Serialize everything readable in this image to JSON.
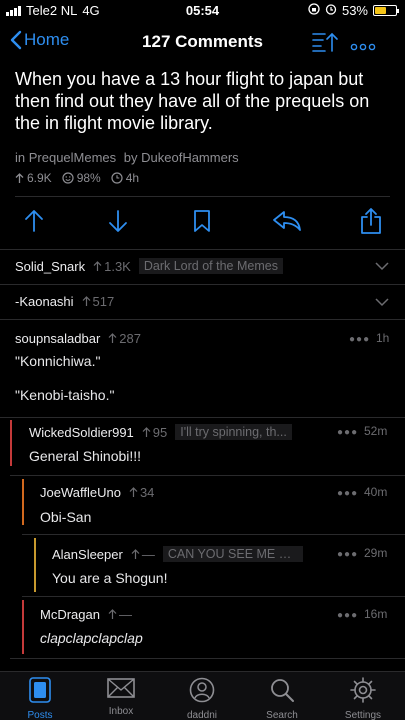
{
  "status_bar": {
    "carrier": "Tele2 NL",
    "network": "4G",
    "time": "05:54",
    "battery": "53%",
    "battery_level": 0.53
  },
  "nav": {
    "back_label": "Home",
    "title": "127 Comments"
  },
  "post": {
    "title": "When you have a 13 hour flight to japan but then find out they have all of the prequels on the in flight movie library.",
    "subreddit": "in PrequelMemes",
    "author": "by DukeofHammers",
    "score": "6.9K",
    "ratio": "98%",
    "age": "4h"
  },
  "comments": [
    {
      "author": "Solid_Snark",
      "score": "1.3K",
      "flair": "Dark Lord of the Memes",
      "collapsed": true
    },
    {
      "author": "-Kaonashi",
      "score": "517",
      "collapsed": true
    },
    {
      "author": "soupnsaladbar",
      "score": "287",
      "time": "1h",
      "body1": "\"Konnichiwa.\"",
      "body2": "\"Kenobi-taisho.\""
    },
    {
      "author": "WickedSoldier991",
      "score": "95",
      "flair": "I'll try spinning, th...",
      "time": "52m",
      "body": "General Shinobi!!!",
      "bar_color": "#c43a3a"
    },
    {
      "author": "JoeWaffleUno",
      "score": "34",
      "time": "40m",
      "body": "Obi-San",
      "bar_color": "#d2691e"
    },
    {
      "author": "AlanSleeper",
      "score": "—",
      "flair": "CAN YOU SEE ME N...",
      "time": "29m",
      "body": "You are a Shogun!",
      "bar_color": "#c89a2e"
    },
    {
      "author": "McDragan",
      "score": "—",
      "time": "16m",
      "body": "clapclapclapclap",
      "bar_color": "#c43a3a"
    }
  ],
  "tabs": [
    {
      "label": "Posts",
      "icon": "posts-icon",
      "active": true
    },
    {
      "label": "Inbox",
      "icon": "inbox-icon"
    },
    {
      "label": "daddni",
      "icon": "profile-icon"
    },
    {
      "label": "Search",
      "icon": "search-icon"
    },
    {
      "label": "Settings",
      "icon": "settings-icon"
    }
  ],
  "colors": {
    "accent": "#2e8ef0",
    "background": "#000000",
    "muted": "#8e8e93"
  }
}
